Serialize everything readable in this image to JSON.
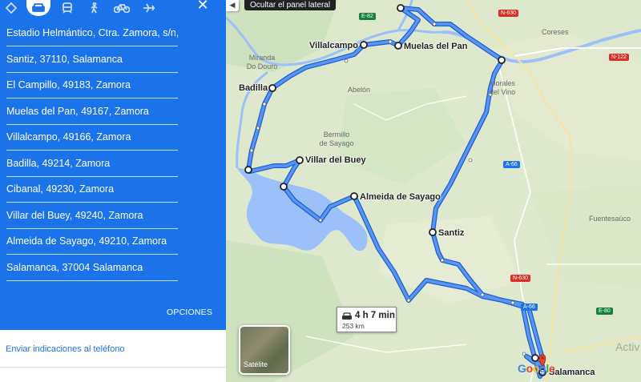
{
  "panel": {
    "modes": [
      {
        "name": "best-route",
        "icon": "diamond-route-icon"
      },
      {
        "name": "driving",
        "icon": "car-icon",
        "selected": true
      },
      {
        "name": "transit",
        "icon": "train-icon"
      },
      {
        "name": "walking",
        "icon": "walking-icon"
      },
      {
        "name": "cycling",
        "icon": "bicycle-icon"
      },
      {
        "name": "flights",
        "icon": "plane-icon"
      }
    ],
    "close_icon": "close-icon",
    "waypoints": [
      "Estadio Helmántico, Ctra. Zamora, s/n,",
      "Santiz, 37110, Salamanca",
      "El Campillo, 49183, Zamora",
      "Muelas del Pan, 49167, Zamora",
      "Villalcampo, 49166, Zamora",
      "Badilla, 49214, Zamora",
      "Cibanal, 49230, Zamora",
      "Villar del Buey, 49240, Zamora",
      "Almeida de Sayago, 49210, Zamora",
      "Salamanca, 37004 Salamanca"
    ],
    "options_label": "OPCIONES",
    "send_link": "Enviar indicaciones al teléfono",
    "accent_color": "#1a73e8"
  },
  "map": {
    "tooltip": "Ocultar el panel lateral",
    "towns": {
      "miranda": "Miranda\nDo Douro",
      "abelon": "Abelón",
      "bermillo": "Bermillo\nde Sayago",
      "coreses": "Coreses",
      "morales": "Morales\ndel Vino",
      "fuentesauco": "Fuentesaúco"
    },
    "waypoint_labels": {
      "villalcampo": "Villalcampo",
      "muelas": "Muelas del Pan",
      "badilla": "Badilla",
      "villar": "Villar del Buey",
      "almeida": "Almeida de Sayago",
      "santiz": "Santiz",
      "salamanca": "Salamanca"
    },
    "roads": {
      "e82": "E-82",
      "n630_top": "N-630",
      "n122": "N-122",
      "a66_mid": "A-66",
      "n630_low": "N-630",
      "a66_low": "A-66",
      "e80": "E-80"
    },
    "duration": "4 h 7 min",
    "distance": "253 km",
    "satellite_label": "Satélite",
    "google_logo": "Google",
    "watermark": "Activ",
    "route_color": "#4285f4"
  }
}
